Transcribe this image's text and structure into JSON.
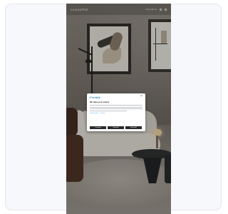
{
  "site": {
    "brand": "LuxuryTest",
    "nav_link": "All products"
  },
  "cookie_dialog": {
    "logo": "Frontify",
    "close_glyph": "×",
    "title": "We value your privacy",
    "links": [
      "Cookie policy",
      "Privacy"
    ],
    "buttons": [
      "Customize",
      "Reject All",
      "Accept All"
    ]
  },
  "icons": [
    "search-icon",
    "cart-icon",
    "close-icon"
  ],
  "colors": {
    "accent": "#2f9bd6",
    "button": "#2a2a2a",
    "overlay": "#141414"
  }
}
